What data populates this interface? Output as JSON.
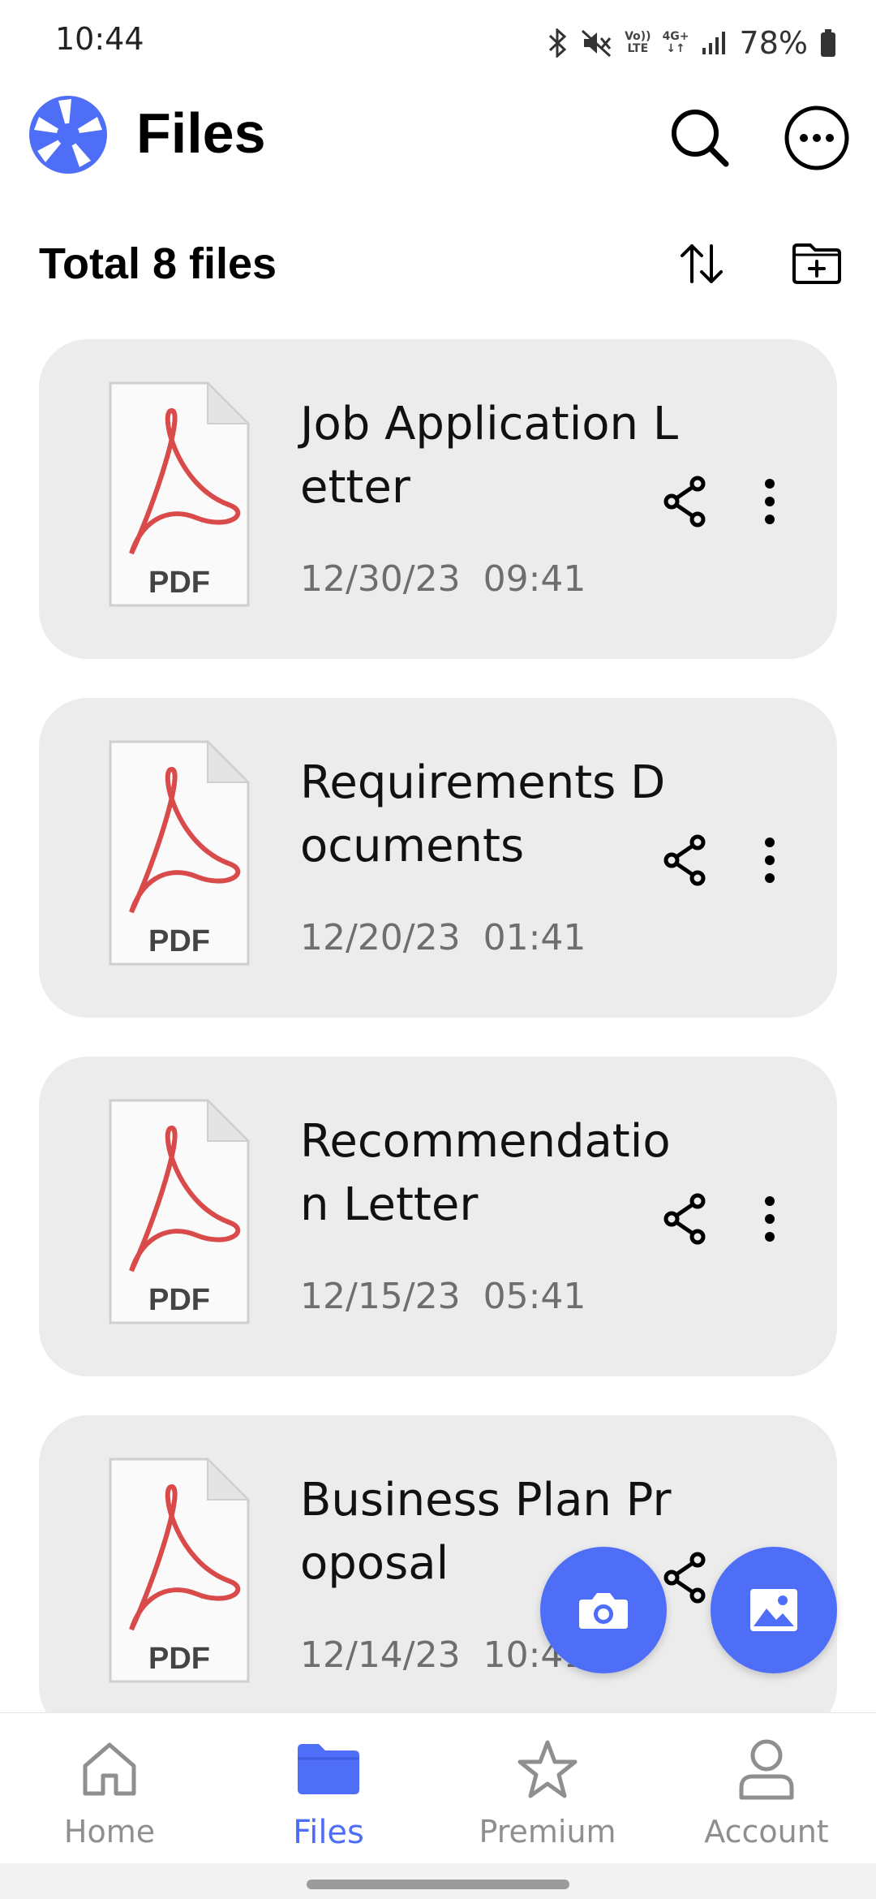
{
  "status_bar": {
    "time": "10:44",
    "network_top": "4G+",
    "volte_top": "Vo))",
    "volte_bottom": "LTE",
    "battery_text": "78%",
    "icons": [
      "bluetooth-icon",
      "mute-icon",
      "volte-icon",
      "4g-icon",
      "signal-icon",
      "battery-icon"
    ]
  },
  "app_bar": {
    "title": "Files",
    "icons": [
      "app-logo-icon",
      "search-icon",
      "more-options-icon"
    ]
  },
  "list_header": {
    "total_label": "Total 8 files",
    "icons": [
      "sort-icon",
      "new-folder-icon"
    ]
  },
  "files": [
    {
      "name": "Job Application Letter",
      "date": "12/30/23  09:41",
      "type_label": "PDF"
    },
    {
      "name": "Requirements Documents",
      "date": "12/20/23  01:41",
      "type_label": "PDF"
    },
    {
      "name": "Recommendation Letter",
      "date": "12/15/23  05:41",
      "type_label": "PDF"
    },
    {
      "name": "Business Plan Proposal",
      "date": "12/14/23  10:41",
      "type_label": "PDF"
    }
  ],
  "fabs": [
    "camera-icon",
    "gallery-icon"
  ],
  "bottom_nav": {
    "items": [
      {
        "label": "Home",
        "icon": "home-icon",
        "active": false
      },
      {
        "label": "Files",
        "icon": "folder-icon",
        "active": true
      },
      {
        "label": "Premium",
        "icon": "star-icon",
        "active": false
      },
      {
        "label": "Account",
        "icon": "account-icon",
        "active": false
      }
    ]
  },
  "colors": {
    "accent": "#4f6ef7",
    "card_bg": "#ececec",
    "pdf_red": "#d94a4a",
    "muted_text": "#6e6e6e"
  }
}
